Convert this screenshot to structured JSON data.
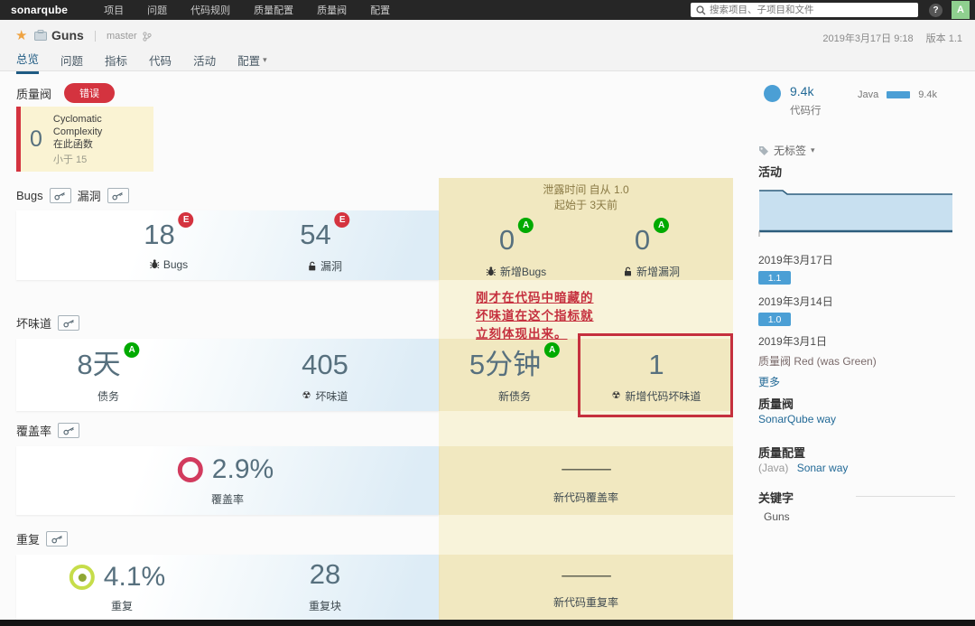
{
  "topbar": {
    "brand": "sonarqube",
    "menu": [
      "项目",
      "问题",
      "代码规则",
      "质量配置",
      "质量阀",
      "配置"
    ],
    "search_placeholder": "搜索项目、子项目和文件",
    "help_label": "?",
    "avatar_label": "A"
  },
  "header": {
    "project": "Guns",
    "branch": "master",
    "analysis_date": "2019年3月17日 9:18",
    "version": "版本 1.1",
    "tabs": [
      "总览",
      "问题",
      "指标",
      "代码",
      "活动",
      "配置"
    ]
  },
  "quality_gate": {
    "title": "质量阀",
    "status": "错误",
    "condition_value": "0",
    "condition_metric": "Cyclomatic Complexity",
    "condition_scope": "在此函数",
    "condition_threshold": "小于 15"
  },
  "bugs_section": {
    "title_bugs": "Bugs",
    "title_vuln": "漏洞",
    "bugs_value": "18",
    "bugs_rating": "E",
    "bugs_label": "Bugs",
    "vuln_value": "54",
    "vuln_rating": "E",
    "vuln_label": "漏洞",
    "leak_title": "泄露时间 自从 1.0",
    "leak_subtitle": "起始于 3天前",
    "new_bugs_value": "0",
    "new_bugs_rating": "A",
    "new_bugs_label": "新增Bugs",
    "new_vuln_value": "0",
    "new_vuln_rating": "A",
    "new_vuln_label": "新增漏洞"
  },
  "annotation": {
    "line1": "刚才在代码中暗藏的",
    "line2": "坏味道在这个指标就",
    "line3": "立刻体现出来。"
  },
  "smells_section": {
    "title": "坏味道",
    "debt_value": "8天",
    "debt_rating": "A",
    "debt_label": "债务",
    "smells_value": "405",
    "smells_label": "坏味道",
    "new_debt_value": "5分钟",
    "new_debt_rating": "A",
    "new_debt_label": "新债务",
    "new_smells_value": "1",
    "new_smells_label": "新增代码坏味道"
  },
  "coverage_section": {
    "title": "覆盖率",
    "coverage_value": "2.9%",
    "coverage_label": "覆盖率",
    "new_coverage_value": "—",
    "new_coverage_label": "新代码覆盖率"
  },
  "duplication_section": {
    "title": "重复",
    "dup_value": "4.1%",
    "dup_label": "重复",
    "blocks_value": "28",
    "blocks_label": "重复块",
    "new_dup_value": "—",
    "new_dup_label": "新代码重复率"
  },
  "sidebar": {
    "loc_value": "9.4k",
    "loc_label": "代码行",
    "language": "Java",
    "language_value": "9.4k",
    "tags_label": "无标签",
    "activity_title": "活动",
    "events": [
      {
        "date": "2019年3月17日",
        "badge": "1.1"
      },
      {
        "date": "2019年3月14日",
        "badge": "1.0"
      },
      {
        "date": "2019年3月1日",
        "text": "质量阀 Red (was Green)",
        "more": "更多"
      }
    ],
    "gate_title": "质量阀",
    "gate_value": "SonarQube way",
    "profile_title": "质量配置",
    "profile_lang": "(Java)",
    "profile_value": "Sonar way",
    "key_title": "关键字",
    "key_value": "Guns"
  },
  "colors": {
    "accent_blue": "#4b9fd5",
    "dark_blue": "#236a97",
    "error_red": "#d4333f",
    "rating_a": "#00aa00",
    "leak_yellow": "#f1e8c0"
  }
}
